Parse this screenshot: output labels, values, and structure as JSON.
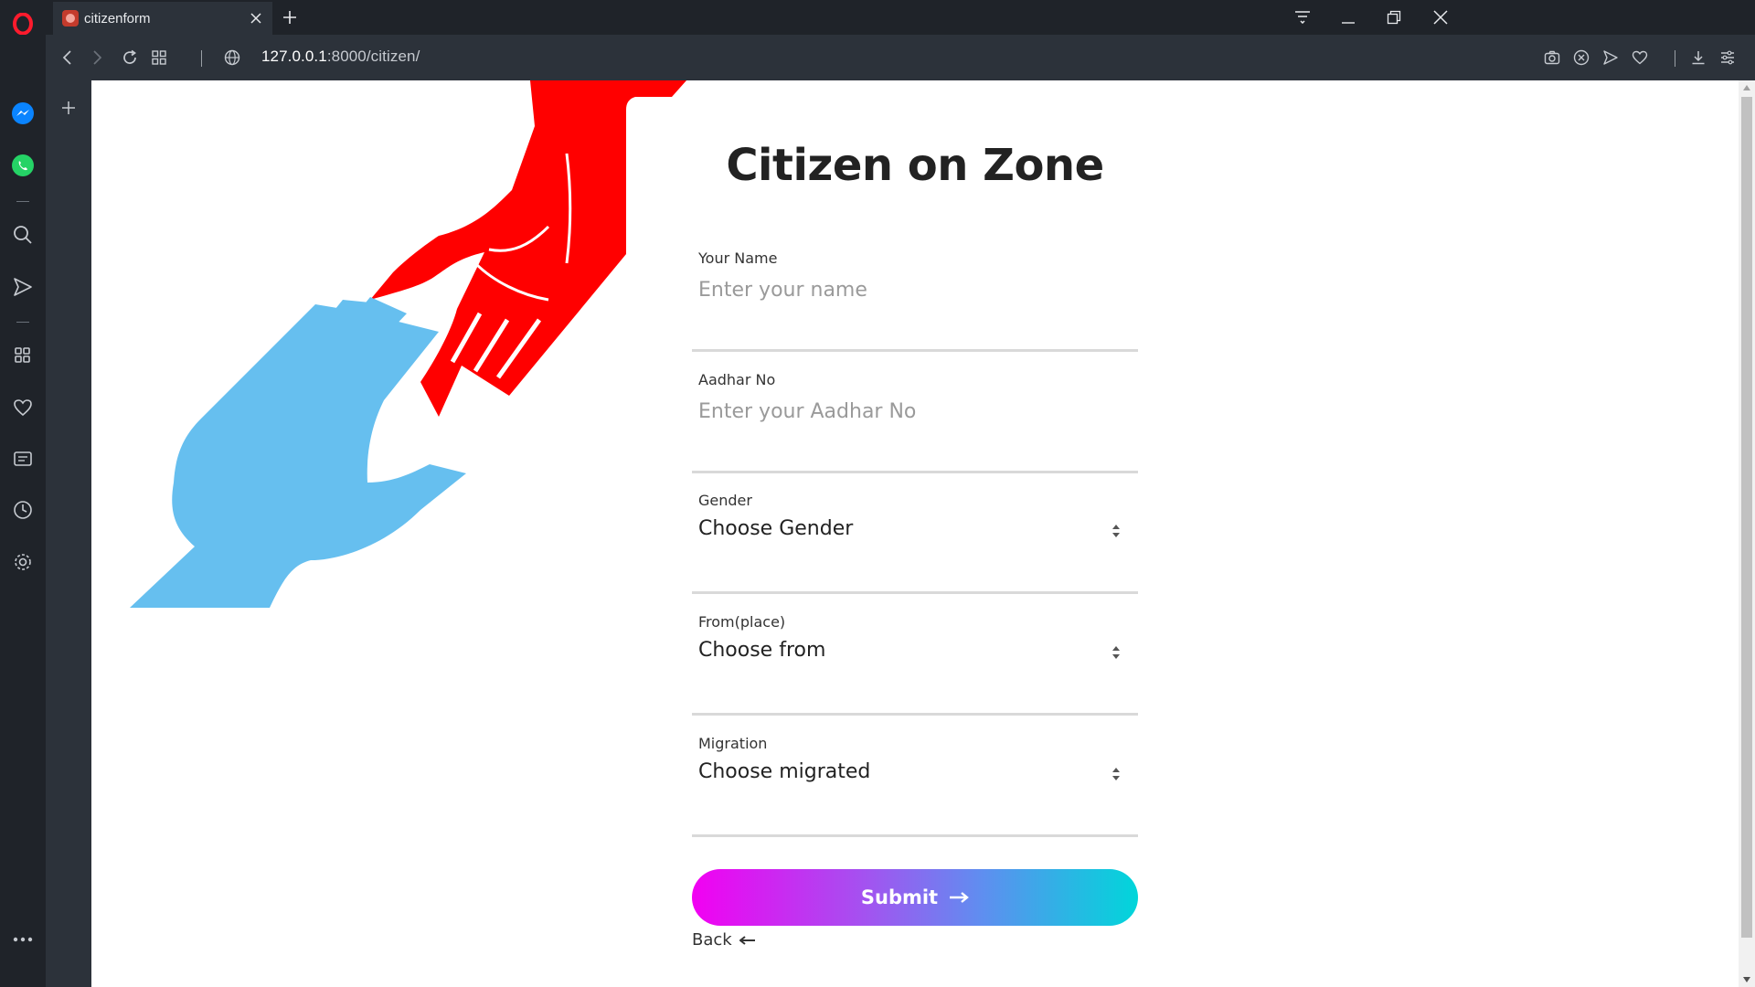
{
  "browser": {
    "tab": {
      "title": "citizenform"
    },
    "address": {
      "host": "127.0.0.1",
      "path": ":8000/citizen/"
    },
    "sidebar_icons": [
      "opera-logo-icon",
      "messenger-icon",
      "whatsapp-icon",
      "search-icon",
      "send-icon",
      "speed-dial-icon",
      "heart-icon",
      "news-icon",
      "history-icon",
      "settings-icon",
      "more-icon"
    ],
    "accent_colors": {
      "opera_red": "#ff1b2d",
      "messenger_blue": "#0a84ff",
      "whatsapp_green": "#25d366"
    }
  },
  "page": {
    "title": "Citizen on Zone",
    "illustration": {
      "red_hand_color": "#ff0000",
      "blue_hand_color": "#66bfef"
    },
    "fields": [
      {
        "label": "Your Name",
        "type": "text",
        "placeholder": "Enter your name",
        "value": ""
      },
      {
        "label": "Aadhar No",
        "type": "text",
        "placeholder": "Enter your Aadhar No",
        "value": ""
      },
      {
        "label": "Gender",
        "type": "select",
        "selected": "Choose Gender"
      },
      {
        "label": "From(place)",
        "type": "select",
        "selected": "Choose from"
      },
      {
        "label": "Migration",
        "type": "select",
        "selected": "Choose migrated"
      }
    ],
    "submit_label": "Submit",
    "back_label": "Back",
    "submit_gradient": [
      "#f200f2",
      "#a155f0",
      "#5f8ef0",
      "#00d6da"
    ]
  }
}
